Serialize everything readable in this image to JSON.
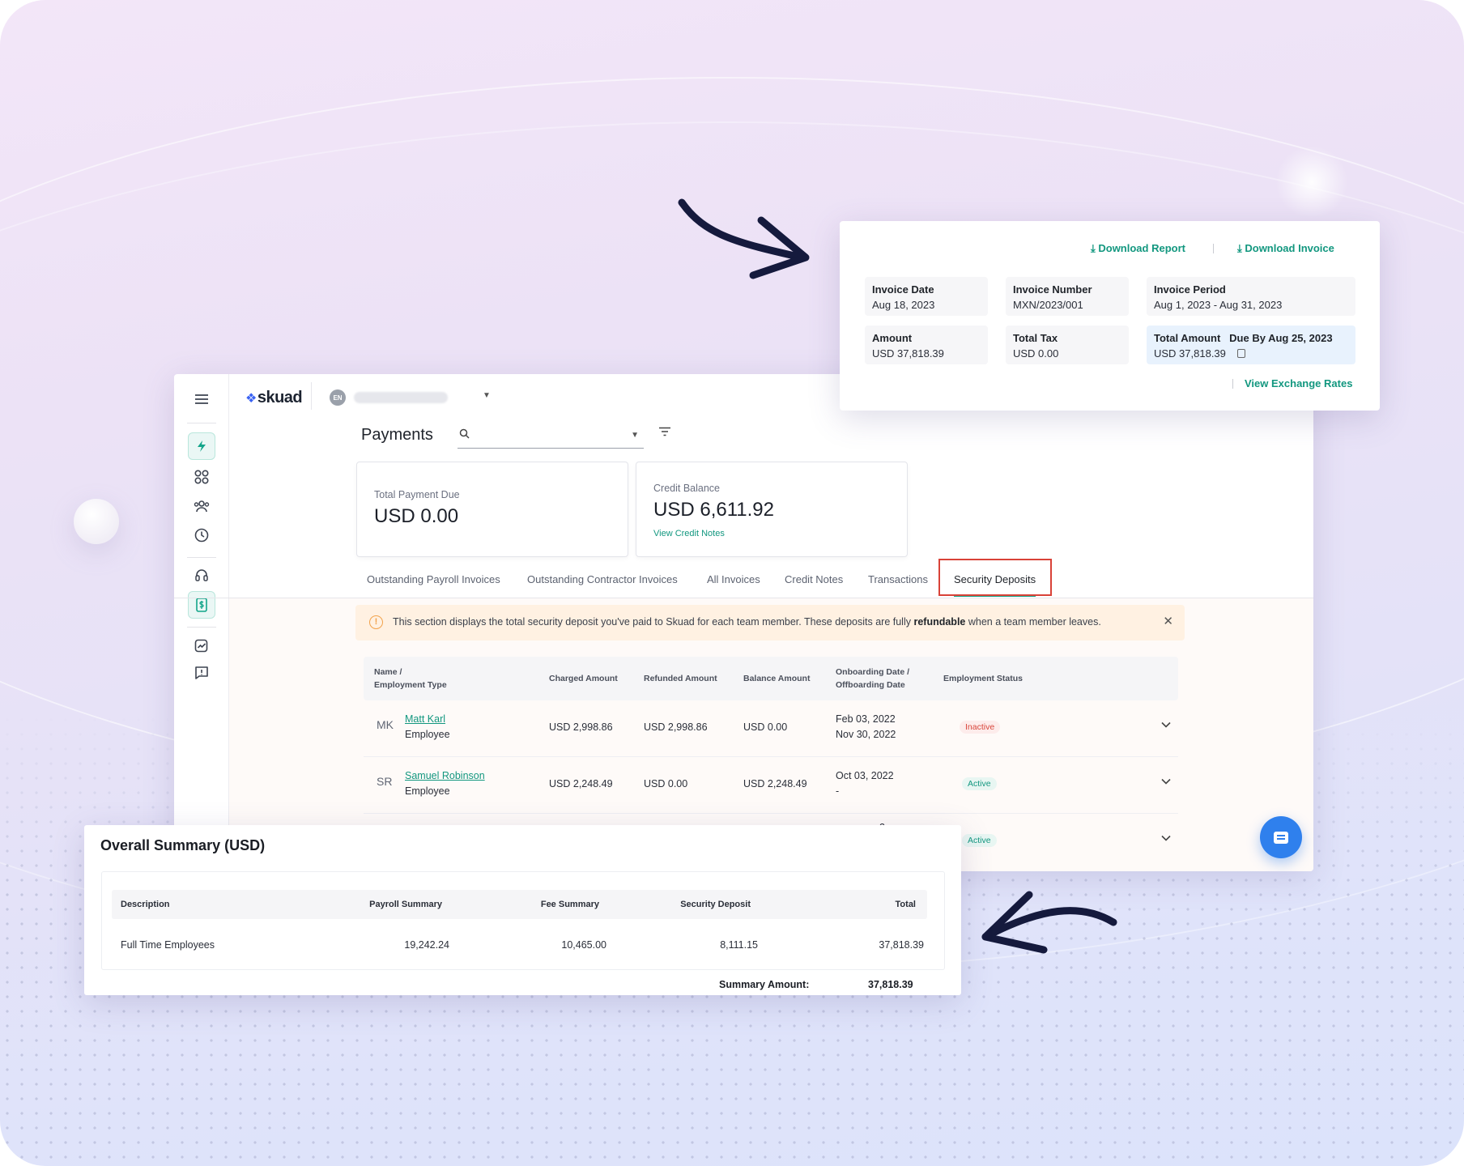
{
  "app": {
    "logo_text": "skuad",
    "language_badge": "EN",
    "page_title": "Payments",
    "search": {
      "placeholder": ""
    },
    "rail_icons": [
      "menu-icon",
      "lightning-icon",
      "dashboard-grid-icon",
      "team-icon",
      "clock-icon",
      "support-headset-icon",
      "payments-icon",
      "analytics-icon",
      "feedback-icon"
    ],
    "stats": [
      {
        "label": "Total Payment Due",
        "value": "USD 0.00"
      },
      {
        "label": "Credit Balance",
        "value": "USD 6,611.92",
        "link": "View Credit Notes"
      }
    ],
    "tabs": [
      "Outstanding Payroll Invoices",
      "Outstanding Contractor Invoices",
      "All Invoices",
      "Credit Notes",
      "Transactions",
      "Security Deposits"
    ],
    "selected_tab": "Security Deposits",
    "notice": {
      "before": "This section displays the total security deposit you've paid to Skuad for each team member. These deposits are fully ",
      "bold": "refundable",
      "after": " when a team member leaves."
    },
    "table": {
      "headers": {
        "name_1": "Name /",
        "name_2": "Employment Type",
        "charged": "Charged Amount",
        "refunded": "Refunded Amount",
        "balance": "Balance Amount",
        "dates_1": "Onboarding Date /",
        "dates_2": "Offboarding Date",
        "status": "Employment Status"
      },
      "rows": [
        {
          "initials": "MK",
          "name": "Matt Karl",
          "type": "Employee",
          "charged": "USD 2,998.86",
          "refunded": "USD 2,998.86",
          "balance": "USD 0.00",
          "onboarding": "Feb 03, 2022",
          "offboarding": "Nov 30, 2022",
          "status": "Inactive"
        },
        {
          "initials": "SR",
          "name": "Samuel Robinson",
          "type": "Employee",
          "charged": "USD 2,248.49",
          "refunded": "USD 0.00",
          "balance": "USD 2,248.49",
          "onboarding": "Oct 03, 2022",
          "offboarding": "-",
          "status": "Active"
        },
        {
          "partial_date": "2",
          "status": "Active"
        }
      ]
    }
  },
  "invoice": {
    "download_report": "Download Report",
    "download_invoice": "Download Invoice",
    "invoice_date_label": "Invoice Date",
    "invoice_date": "Aug 18, 2023",
    "invoice_number_label": "Invoice Number",
    "invoice_number": "MXN/2023/001",
    "invoice_period_label": "Invoice Period",
    "invoice_period": "Aug 1, 2023 - Aug 31, 2023",
    "amount_label": "Amount",
    "amount": "USD 37,818.39",
    "total_tax_label": "Total Tax",
    "total_tax": "USD 0.00",
    "total_amount_label": "Total Amount",
    "due_by": "Due By Aug 25, 2023",
    "total_amount": "USD 37,818.39",
    "exchange_rates_link": "View Exchange Rates"
  },
  "summary": {
    "title": "Overall Summary (USD)",
    "headers": [
      "Description",
      "Payroll Summary",
      "Fee Summary",
      "Security Deposit",
      "Total"
    ],
    "row": [
      "Full Time Employees",
      "19,242.24",
      "10,465.00",
      "8,111.15",
      "37,818.39"
    ],
    "summary_amount_label": "Summary Amount:",
    "summary_amount": "37,818.39"
  },
  "colors": {
    "accent": "#13a58a",
    "link": "#12977f",
    "highlight_border": "#d94238",
    "notice_bg": "#fff1e2",
    "chat_button": "#2f80ed",
    "arrow": "#151a3d"
  }
}
